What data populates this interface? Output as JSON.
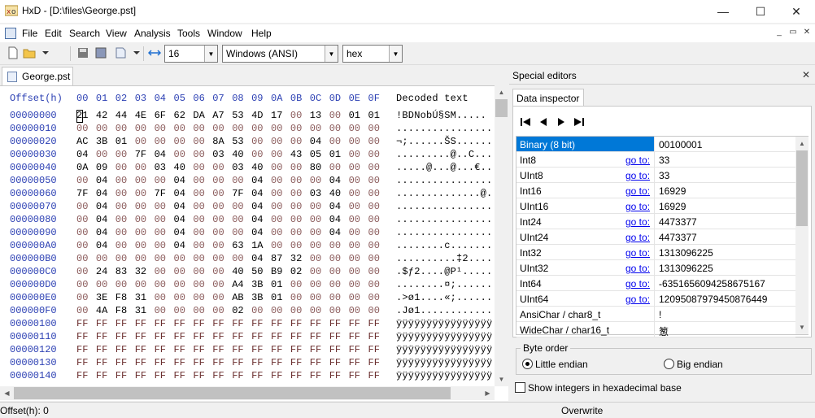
{
  "window": {
    "title": "HxD - [D:\\files\\George.pst]",
    "minimize": "—",
    "maximize": "☐",
    "close": "✕"
  },
  "menu": [
    "File",
    "Edit",
    "Search",
    "View",
    "Analysis",
    "Tools",
    "Window",
    "Help"
  ],
  "mdi_buttons": [
    "_",
    "▭",
    "✕"
  ],
  "toolbar": {
    "bytes_per_row": "16",
    "charset": "Windows (ANSI)",
    "offset_base": "hex",
    "icons": [
      "new-file-icon",
      "open-folder-icon",
      "dropdown-arrow-icon",
      "save-icon",
      "delete-icon",
      "disk-icon",
      "export-icon",
      "columns-icon"
    ]
  },
  "document_tab": "George.pst",
  "hex_header": {
    "offset_label": "Offset(h)",
    "columns": [
      "00",
      "01",
      "02",
      "03",
      "04",
      "05",
      "06",
      "07",
      "08",
      "09",
      "0A",
      "0B",
      "0C",
      "0D",
      "0E",
      "0F"
    ],
    "decoded_label": "Decoded text"
  },
  "hex_rows": [
    {
      "offset": "00000000",
      "bytes": [
        "21",
        "42",
        "44",
        "4E",
        "6F",
        "62",
        "DA",
        "A7",
        "53",
        "4D",
        "17",
        "00",
        "13",
        "00",
        "01",
        "01"
      ],
      "decoded": "!BDNobÚ§SM....."
    },
    {
      "offset": "00000010",
      "bytes": [
        "00",
        "00",
        "00",
        "00",
        "00",
        "00",
        "00",
        "00",
        "00",
        "00",
        "00",
        "00",
        "00",
        "00",
        "00",
        "00"
      ],
      "decoded": "................"
    },
    {
      "offset": "00000020",
      "bytes": [
        "AC",
        "3B",
        "01",
        "00",
        "00",
        "00",
        "00",
        "8A",
        "53",
        "00",
        "00",
        "00",
        "04",
        "00",
        "00",
        "00"
      ],
      "decoded": "¬;......ŠS......"
    },
    {
      "offset": "00000030",
      "bytes": [
        "04",
        "00",
        "00",
        "7F",
        "04",
        "00",
        "00",
        "03",
        "40",
        "00",
        "00",
        "43",
        "05",
        "01",
        "00",
        "00"
      ],
      "decoded": ".........@..C..."
    },
    {
      "offset": "00000040",
      "bytes": [
        "0A",
        "09",
        "00",
        "00",
        "03",
        "40",
        "00",
        "00",
        "03",
        "40",
        "00",
        "00",
        "80",
        "00",
        "00",
        "00"
      ],
      "decoded": ".....@...@...€..."
    },
    {
      "offset": "00000050",
      "bytes": [
        "00",
        "04",
        "00",
        "00",
        "00",
        "04",
        "00",
        "00",
        "00",
        "04",
        "00",
        "00",
        "00",
        "04",
        "00",
        "00"
      ],
      "decoded": "................"
    },
    {
      "offset": "00000060",
      "bytes": [
        "7F",
        "04",
        "00",
        "00",
        "7F",
        "04",
        "00",
        "00",
        "7F",
        "04",
        "00",
        "00",
        "03",
        "40",
        "00",
        "00"
      ],
      "decoded": "..............@."
    },
    {
      "offset": "00000070",
      "bytes": [
        "00",
        "04",
        "00",
        "00",
        "00",
        "04",
        "00",
        "00",
        "00",
        "04",
        "00",
        "00",
        "00",
        "04",
        "00",
        "00"
      ],
      "decoded": "................"
    },
    {
      "offset": "00000080",
      "bytes": [
        "00",
        "04",
        "00",
        "00",
        "00",
        "04",
        "00",
        "00",
        "00",
        "04",
        "00",
        "00",
        "00",
        "04",
        "00",
        "00"
      ],
      "decoded": "................"
    },
    {
      "offset": "00000090",
      "bytes": [
        "00",
        "04",
        "00",
        "00",
        "00",
        "04",
        "00",
        "00",
        "00",
        "04",
        "00",
        "00",
        "00",
        "04",
        "00",
        "00"
      ],
      "decoded": "................"
    },
    {
      "offset": "000000A0",
      "bytes": [
        "00",
        "04",
        "00",
        "00",
        "00",
        "04",
        "00",
        "00",
        "63",
        "1A",
        "00",
        "00",
        "00",
        "00",
        "00",
        "00"
      ],
      "decoded": "........c......."
    },
    {
      "offset": "000000B0",
      "bytes": [
        "00",
        "00",
        "00",
        "00",
        "00",
        "00",
        "00",
        "00",
        "00",
        "04",
        "87",
        "32",
        "00",
        "00",
        "00",
        "00"
      ],
      "decoded": "..........‡2....."
    },
    {
      "offset": "000000C0",
      "bytes": [
        "00",
        "24",
        "83",
        "32",
        "00",
        "00",
        "00",
        "00",
        "40",
        "50",
        "B9",
        "02",
        "00",
        "00",
        "00",
        "00"
      ],
      "decoded": ".$ƒ2....@P¹....."
    },
    {
      "offset": "000000D0",
      "bytes": [
        "00",
        "00",
        "00",
        "00",
        "00",
        "00",
        "00",
        "00",
        "A4",
        "3B",
        "01",
        "00",
        "00",
        "00",
        "00",
        "00"
      ],
      "decoded": "........¤;......"
    },
    {
      "offset": "000000E0",
      "bytes": [
        "00",
        "3E",
        "F8",
        "31",
        "00",
        "00",
        "00",
        "00",
        "AB",
        "3B",
        "01",
        "00",
        "00",
        "00",
        "00",
        "00"
      ],
      "decoded": ".>ø1....«;......"
    },
    {
      "offset": "000000F0",
      "bytes": [
        "00",
        "4A",
        "F8",
        "31",
        "00",
        "00",
        "00",
        "00",
        "02",
        "00",
        "00",
        "00",
        "00",
        "00",
        "00",
        "00"
      ],
      "decoded": ".Jø1............"
    },
    {
      "offset": "00000100",
      "bytes": [
        "FF",
        "FF",
        "FF",
        "FF",
        "FF",
        "FF",
        "FF",
        "FF",
        "FF",
        "FF",
        "FF",
        "FF",
        "FF",
        "FF",
        "FF",
        "FF"
      ],
      "decoded": "ÿÿÿÿÿÿÿÿÿÿÿÿÿÿÿÿ"
    },
    {
      "offset": "00000110",
      "bytes": [
        "FF",
        "FF",
        "FF",
        "FF",
        "FF",
        "FF",
        "FF",
        "FF",
        "FF",
        "FF",
        "FF",
        "FF",
        "FF",
        "FF",
        "FF",
        "FF"
      ],
      "decoded": "ÿÿÿÿÿÿÿÿÿÿÿÿÿÿÿÿ"
    },
    {
      "offset": "00000120",
      "bytes": [
        "FF",
        "FF",
        "FF",
        "FF",
        "FF",
        "FF",
        "FF",
        "FF",
        "FF",
        "FF",
        "FF",
        "FF",
        "FF",
        "FF",
        "FF",
        "FF"
      ],
      "decoded": "ÿÿÿÿÿÿÿÿÿÿÿÿÿÿÿÿ"
    },
    {
      "offset": "00000130",
      "bytes": [
        "FF",
        "FF",
        "FF",
        "FF",
        "FF",
        "FF",
        "FF",
        "FF",
        "FF",
        "FF",
        "FF",
        "FF",
        "FF",
        "FF",
        "FF",
        "FF"
      ],
      "decoded": "ÿÿÿÿÿÿÿÿÿÿÿÿÿÿÿÿ"
    },
    {
      "offset": "00000140",
      "bytes": [
        "FF",
        "FF",
        "FF",
        "FF",
        "FF",
        "FF",
        "FF",
        "FF",
        "FF",
        "FF",
        "FF",
        "FF",
        "FF",
        "FF",
        "FF",
        "FF"
      ],
      "decoded": "ÿÿÿÿÿÿÿÿÿÿÿÿÿÿÿÿ"
    }
  ],
  "special_editors": {
    "title": "Special editors",
    "close": "✕",
    "tab": "Data inspector"
  },
  "inspector": {
    "goto_label": "go to:",
    "rows": [
      {
        "name": "Binary (8 bit)",
        "value": "00100001",
        "has_goto": false,
        "selected": true
      },
      {
        "name": "Int8",
        "value": "33",
        "has_goto": true
      },
      {
        "name": "UInt8",
        "value": "33",
        "has_goto": true
      },
      {
        "name": "Int16",
        "value": "16929",
        "has_goto": true
      },
      {
        "name": "UInt16",
        "value": "16929",
        "has_goto": true
      },
      {
        "name": "Int24",
        "value": "4473377",
        "has_goto": true
      },
      {
        "name": "UInt24",
        "value": "4473377",
        "has_goto": true
      },
      {
        "name": "Int32",
        "value": "1313096225",
        "has_goto": true
      },
      {
        "name": "UInt32",
        "value": "1313096225",
        "has_goto": true
      },
      {
        "name": "Int64",
        "value": "-6351656094258675167",
        "has_goto": true
      },
      {
        "name": "UInt64",
        "value": "12095087979450876449",
        "has_goto": true
      },
      {
        "name": "AnsiChar / char8_t",
        "value": "!",
        "has_goto": false
      },
      {
        "name": "WideChar / char16_t",
        "value": "䈡",
        "has_goto": false
      }
    ]
  },
  "byte_order": {
    "label": "Byte order",
    "little": "Little endian",
    "big": "Big endian",
    "selected": "little"
  },
  "hex_checkbox": "Show integers in hexadecimal base",
  "status": {
    "offset": "Offset(h): 0",
    "mode": "Overwrite"
  },
  "colors": {
    "offset_blue": "#2b3fb3",
    "selection_blue": "#0078d7",
    "zero_byte": "#8a5a5a"
  }
}
